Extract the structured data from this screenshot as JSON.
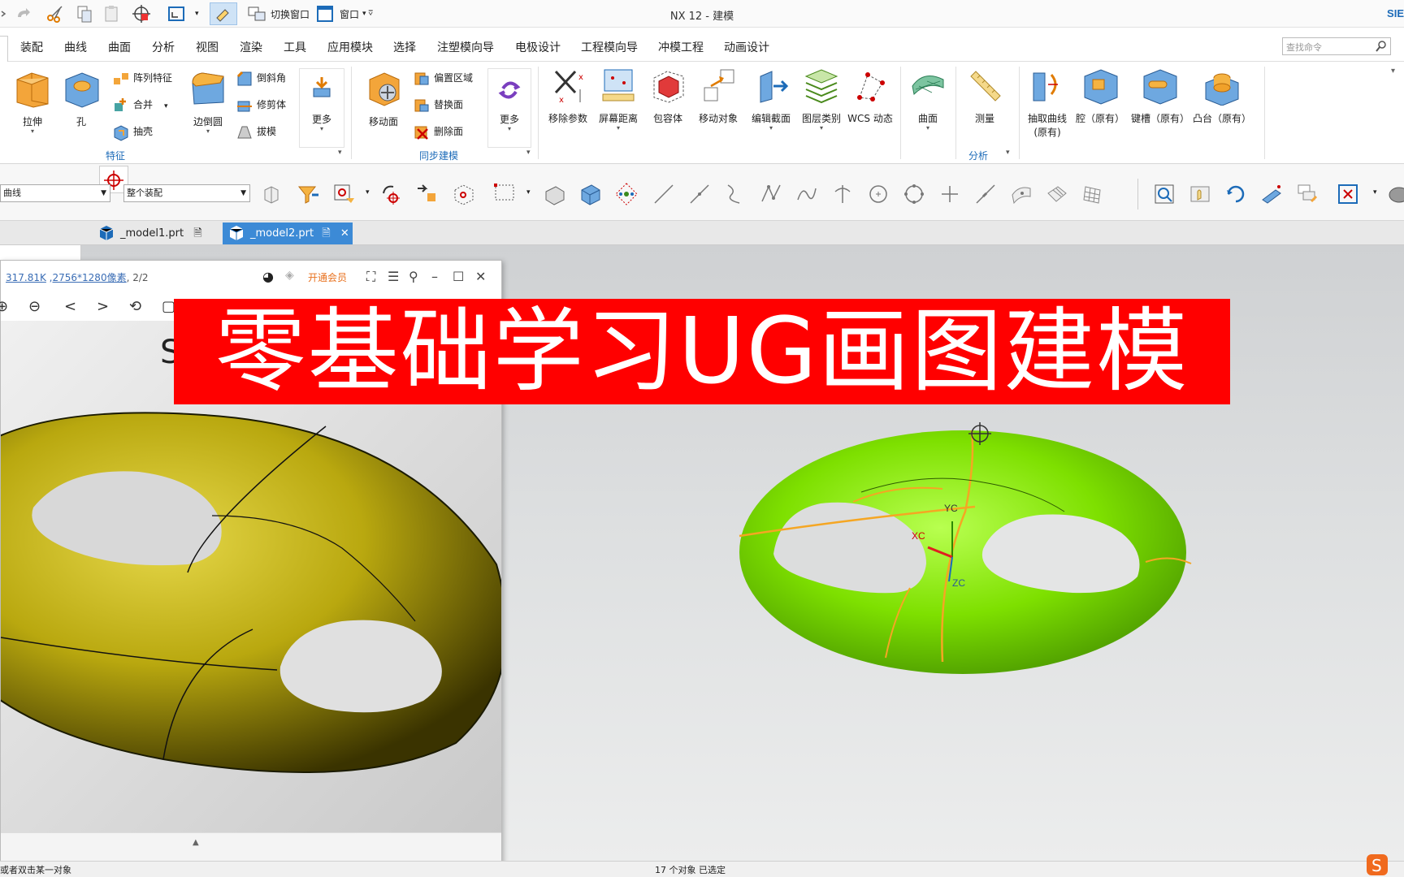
{
  "window": {
    "title": "NX 12 - 建模",
    "brand": "SIE"
  },
  "quick_access": {
    "switch_window": "切换窗口",
    "window_menu": "窗口"
  },
  "menu_tabs": [
    "装配",
    "曲线",
    "曲面",
    "分析",
    "视图",
    "渲染",
    "工具",
    "应用模块",
    "选择",
    "注塑模向导",
    "电极设计",
    "工程模向导",
    "冲模工程",
    "动画设计"
  ],
  "search": {
    "placeholder": "查找命令"
  },
  "ribbon": {
    "feature_group": {
      "label": "特征",
      "extrude": "拉伸",
      "hole": "孔",
      "pattern": "阵列特征",
      "unite": "合并",
      "shell": "抽壳",
      "edge_blend": "边倒圆",
      "chamfer": "倒斜角",
      "trim_body": "修剪体",
      "draft": "拔模",
      "more": "更多"
    },
    "sync_group": {
      "label": "同步建模",
      "move_face": "移动面",
      "offset_region": "偏置区域",
      "replace_face": "替换面",
      "delete_face": "删除面",
      "more": "更多"
    },
    "tools": {
      "remove_params": "移除参数",
      "screen_distance": "屏幕距离",
      "bounding_body": "包容体",
      "move_object": "移动对象",
      "edit_section": "编辑截面",
      "layer_category": "图层类别",
      "wcs_dynamic": "WCS 动态",
      "surface": "曲面",
      "measure": "测量",
      "analysis": "分析"
    },
    "legacy": {
      "extract_curve": "抽取曲线",
      "extract_curve_sub": "(原有)",
      "pocket": "腔（原有）",
      "slot": "键槽（原有）",
      "boss": "凸台（原有）"
    }
  },
  "filters": {
    "type_filter": "曲线",
    "scope_filter": "整个装配"
  },
  "file_tabs": [
    {
      "name": "_model1.prt",
      "active": false
    },
    {
      "name": "_model2.prt",
      "active": true
    }
  ],
  "image_viewer": {
    "size": "317.81K",
    "dimensions": "2756*1280像素",
    "page": ", 2/2",
    "vip": "开通会员"
  },
  "banner": {
    "text": "零基础学习UG画图建模"
  },
  "viewport": {
    "axes": {
      "x": "XC",
      "y": "YC",
      "z": "ZC"
    }
  },
  "status": {
    "left": "或者双击某一对象",
    "center": "17 个对象 已选定"
  },
  "colors": {
    "model_green": "#7ee000",
    "edge_orange": "#f5a623",
    "banner_red": "#ff0000",
    "photo_yellow": "#b9a80f"
  }
}
